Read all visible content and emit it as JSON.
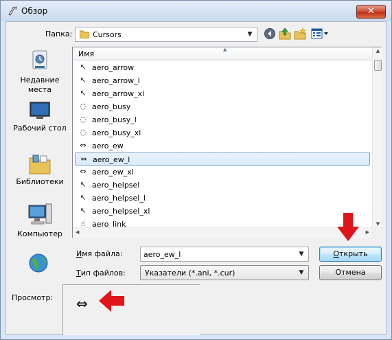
{
  "window": {
    "title": "Обзор",
    "close_glyph": "✕"
  },
  "folder": {
    "label": "Папка:",
    "value": "Cursors",
    "icon": "folder-icon"
  },
  "toolbar": {
    "icons": [
      "back-icon",
      "up-folder-icon",
      "new-folder-icon",
      "view-menu-icon"
    ]
  },
  "places": [
    {
      "label": "Недавние места",
      "icon": "recent-places-icon"
    },
    {
      "label": "Рабочий стол",
      "icon": "desktop-icon"
    },
    {
      "label": "Библиотеки",
      "icon": "libraries-icon"
    },
    {
      "label": "Компьютер",
      "icon": "computer-icon"
    },
    {
      "label": "",
      "icon": "network-icon"
    }
  ],
  "file_list": {
    "column_header": "Имя",
    "rows": [
      {
        "name": "aero_arrow",
        "glyph": "↖"
      },
      {
        "name": "aero_arrow_l",
        "glyph": "↖"
      },
      {
        "name": "aero_arrow_xl",
        "glyph": "↖"
      },
      {
        "name": "aero_busy",
        "glyph": "◌"
      },
      {
        "name": "aero_busy_l",
        "glyph": "◌"
      },
      {
        "name": "aero_busy_xl",
        "glyph": "◌"
      },
      {
        "name": "aero_ew",
        "glyph": "⇔"
      },
      {
        "name": "aero_ew_l",
        "glyph": "⇔"
      },
      {
        "name": "aero_ew_xl",
        "glyph": "⇔"
      },
      {
        "name": "aero_helpsel",
        "glyph": "↖"
      },
      {
        "name": "aero_helpsel_l",
        "glyph": "↖"
      },
      {
        "name": "aero_helpsel_xl",
        "glyph": "↖"
      },
      {
        "name": "aero_link",
        "glyph": "☝"
      }
    ],
    "selected_row": "aero_ew_l"
  },
  "filename": {
    "label_prefix": "И",
    "label_rest": "мя файла:",
    "value": "aero_ew_l"
  },
  "filetype": {
    "label_prefix": "Т",
    "label_rest": "ип файлов:",
    "value": "Указатели (*.ani, *.cur)"
  },
  "buttons": {
    "open_prefix": "О",
    "open_rest": "ткрыть",
    "cancel": "Отмена"
  },
  "preview": {
    "label": "Просмотр:",
    "glyph": "⇔"
  },
  "colors": {
    "annotation_arrow": "#e0141b",
    "selection_border": "#7da2ce"
  }
}
